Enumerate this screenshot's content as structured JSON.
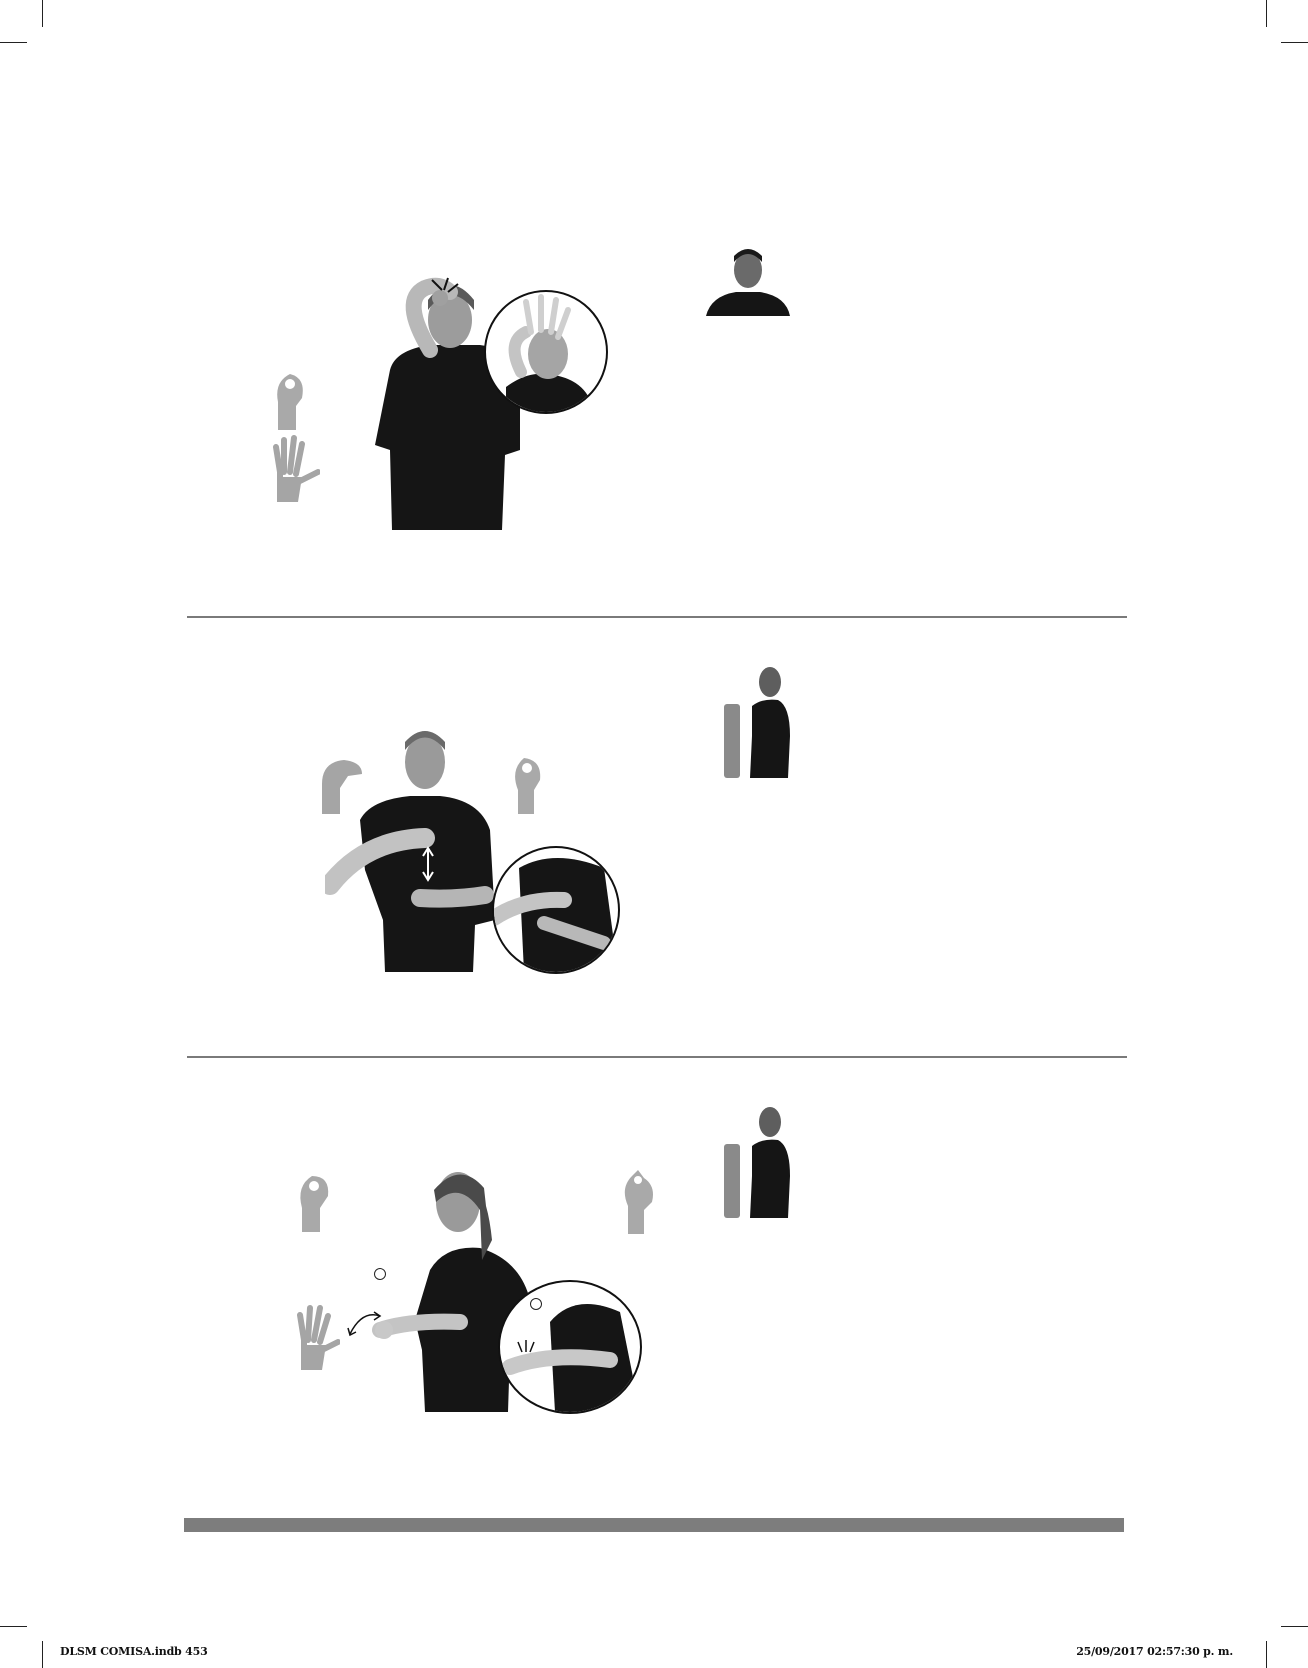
{
  "footer": {
    "file_label": "DLSM COMISA.indb   453",
    "timestamp": "25/09/2017   02:57:30 p. m."
  },
  "entries": [
    {
      "name": "entry-1",
      "signer": "young man, hand on forehead",
      "reference": "front-facing portrait"
    },
    {
      "name": "entry-2",
      "signer": "young man, hands at chest",
      "reference": "side profile with height bar"
    },
    {
      "name": "entry-3",
      "signer": "girl with braid, hands at waist",
      "reference": "side profile with height bar"
    }
  ],
  "colors": {
    "rule": "#7a7a7a",
    "bar": "#7d7d7d",
    "shirt": "#151515",
    "skin": "#bdbdbd",
    "height_bar": "#8a8a8a"
  }
}
